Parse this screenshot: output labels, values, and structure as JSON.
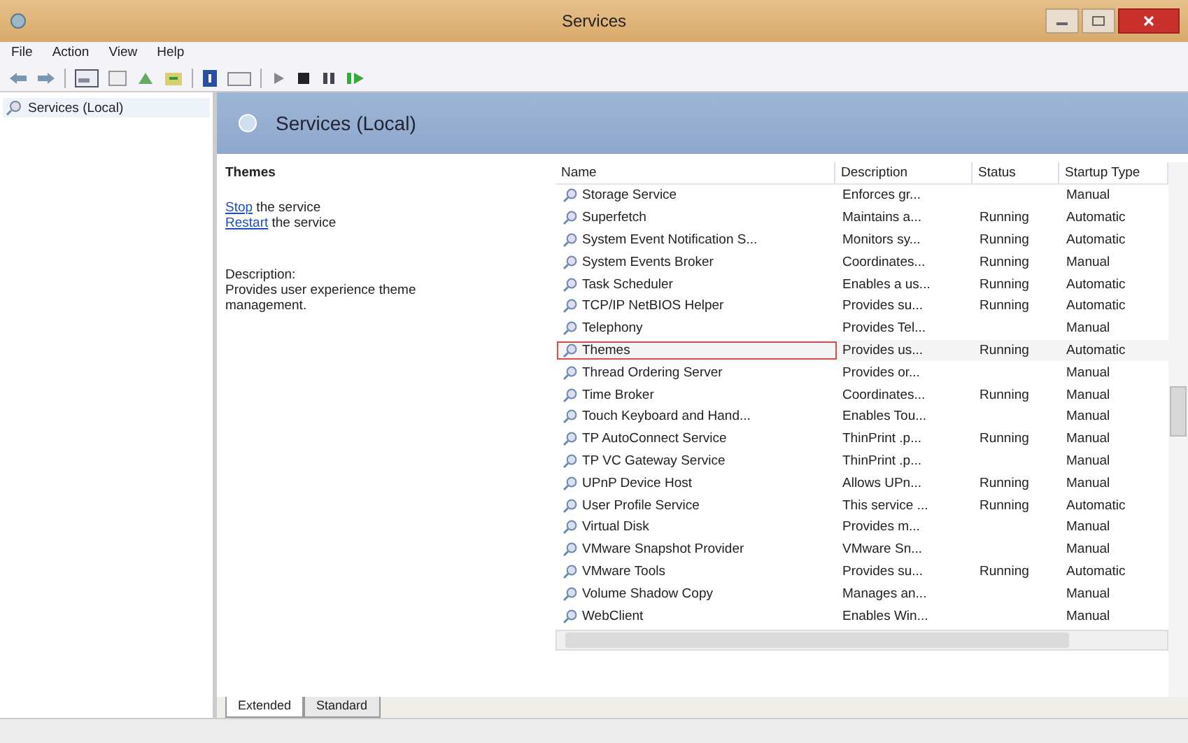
{
  "window": {
    "title": "Services"
  },
  "menu": [
    "File",
    "Action",
    "View",
    "Help"
  ],
  "tree": {
    "items": [
      {
        "label": "Services (Local)",
        "selected": true
      }
    ]
  },
  "header": {
    "title": "Services (Local)"
  },
  "detail": {
    "service_name": "Themes",
    "actions": [
      {
        "link": "Stop",
        "text": " the service"
      },
      {
        "link": "Restart",
        "text": " the service"
      }
    ],
    "description_label": "Description:",
    "description": "Provides user experience theme management."
  },
  "table": {
    "columns": [
      "Name",
      "Description",
      "Status",
      "Startup Type"
    ],
    "rows": [
      {
        "name": "Storage Service",
        "description": "Enforces gr...",
        "status": "",
        "startup": "Manual",
        "selected": false
      },
      {
        "name": "Superfetch",
        "description": "Maintains a...",
        "status": "Running",
        "startup": "Automatic",
        "selected": false
      },
      {
        "name": "System Event Notification S...",
        "description": "Monitors sy...",
        "status": "Running",
        "startup": "Automatic",
        "selected": false
      },
      {
        "name": "System Events Broker",
        "description": "Coordinates...",
        "status": "Running",
        "startup": "Manual",
        "selected": false
      },
      {
        "name": "Task Scheduler",
        "description": "Enables a us...",
        "status": "Running",
        "startup": "Automatic",
        "selected": false
      },
      {
        "name": "TCP/IP NetBIOS Helper",
        "description": "Provides su...",
        "status": "Running",
        "startup": "Automatic",
        "selected": false
      },
      {
        "name": "Telephony",
        "description": "Provides Tel...",
        "status": "",
        "startup": "Manual",
        "selected": false
      },
      {
        "name": "Themes",
        "description": "Provides us...",
        "status": "Running",
        "startup": "Automatic",
        "selected": true
      },
      {
        "name": "Thread Ordering Server",
        "description": "Provides or...",
        "status": "",
        "startup": "Manual",
        "selected": false
      },
      {
        "name": "Time Broker",
        "description": "Coordinates...",
        "status": "Running",
        "startup": "Manual",
        "selected": false
      },
      {
        "name": "Touch Keyboard and Hand...",
        "description": "Enables Tou...",
        "status": "",
        "startup": "Manual",
        "selected": false
      },
      {
        "name": "TP AutoConnect Service",
        "description": "ThinPrint .p...",
        "status": "Running",
        "startup": "Manual",
        "selected": false
      },
      {
        "name": "TP VC Gateway Service",
        "description": "ThinPrint .p...",
        "status": "",
        "startup": "Manual",
        "selected": false
      },
      {
        "name": "UPnP Device Host",
        "description": "Allows UPn...",
        "status": "Running",
        "startup": "Manual",
        "selected": false
      },
      {
        "name": "User Profile Service",
        "description": "This service ...",
        "status": "Running",
        "startup": "Automatic",
        "selected": false
      },
      {
        "name": "Virtual Disk",
        "description": "Provides m...",
        "status": "",
        "startup": "Manual",
        "selected": false
      },
      {
        "name": "VMware Snapshot Provider",
        "description": "VMware Sn...",
        "status": "",
        "startup": "Manual",
        "selected": false
      },
      {
        "name": "VMware Tools",
        "description": "Provides su...",
        "status": "Running",
        "startup": "Automatic",
        "selected": false
      },
      {
        "name": "Volume Shadow Copy",
        "description": "Manages an...",
        "status": "",
        "startup": "Manual",
        "selected": false
      },
      {
        "name": "WebClient",
        "description": "Enables Win...",
        "status": "",
        "startup": "Manual",
        "selected": false
      }
    ]
  },
  "tabs": [
    {
      "label": "Extended",
      "selected": true
    },
    {
      "label": "Standard",
      "selected": false
    }
  ]
}
